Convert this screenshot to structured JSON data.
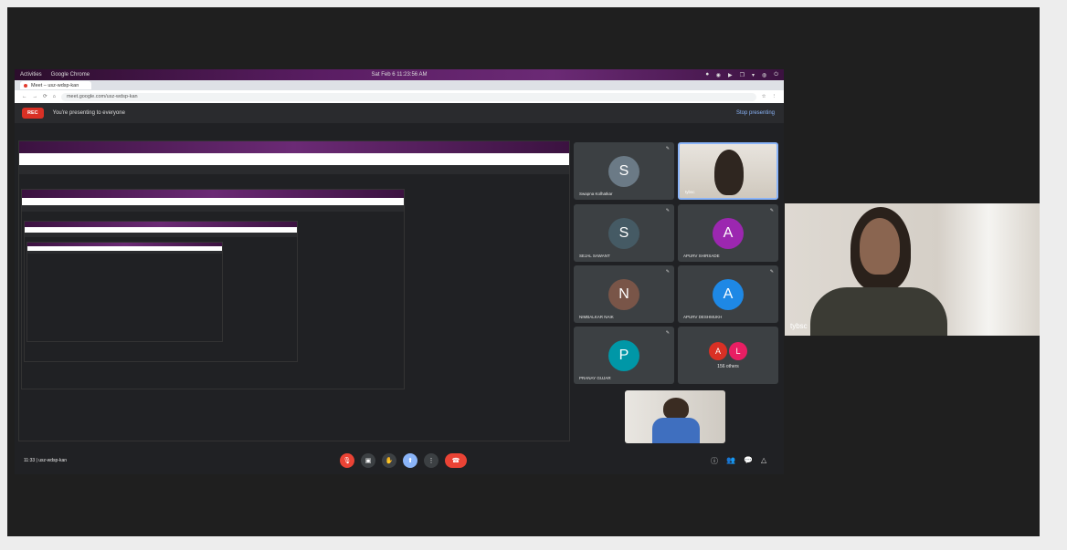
{
  "system_bar": {
    "activities": "Activities",
    "app": "Google Chrome",
    "clock": "Sat Feb 6  11:23:56 AM",
    "tray": [
      "⏺",
      "◉",
      "▶",
      "❐",
      "▾",
      "◍",
      "⏻"
    ]
  },
  "browser": {
    "tab_title": "Meet – usz-wdsp-kan",
    "url": "meet.google.com/usz-wdsp-kan",
    "nav_icons": [
      "←",
      "→",
      "⟳",
      "⌂"
    ],
    "toolbar_icons": [
      "☆",
      "⋮"
    ]
  },
  "presenting": {
    "rec_label": "REC",
    "message": "You're presenting to everyone",
    "stop_label": "Stop presenting"
  },
  "participants": [
    {
      "initial": "S",
      "name": "Swapna Kolhatkar",
      "color": "#6b7a86"
    },
    {
      "initial": "S",
      "name": "SEJAL SAWANT",
      "color": "#455a64"
    },
    {
      "initial": "A",
      "name": "APURV SHIRSADE",
      "color": "#9c27b0"
    },
    {
      "initial": "N",
      "name": "NIMBALKAR NAIK",
      "color": "#795548"
    },
    {
      "initial": "A",
      "name": "APURV DESHMUKH",
      "color": "#1e88e5"
    },
    {
      "initial": "P",
      "name": "PRANAY GUJAR",
      "color": "#0097a7"
    }
  ],
  "others": {
    "initials": [
      "A",
      "L"
    ],
    "label": "156 others",
    "colors": [
      "#d93025",
      "#e91e63"
    ]
  },
  "presenter_tile_name": "tybsc",
  "meeting": {
    "time_code": "11:33  |  usz-wdsp-kan"
  },
  "controls": {
    "mic_icon": "🎙",
    "cam_icon": "▣",
    "hand_icon": "✋",
    "present_icon": "⬆",
    "more_icon": "⋮",
    "end_icon": "☎"
  },
  "right_icons": [
    "ⓘ",
    "👥",
    "💬",
    "△"
  ],
  "self_view": {
    "label": "tybsc"
  }
}
